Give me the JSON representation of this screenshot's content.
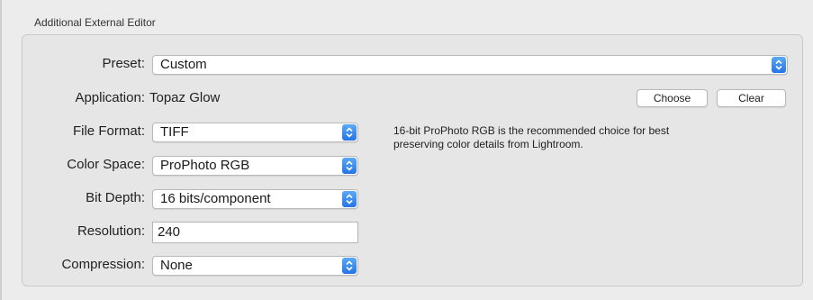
{
  "section": {
    "title": "Additional External Editor"
  },
  "preset": {
    "label": "Preset:",
    "value": "Custom"
  },
  "application": {
    "label": "Application:",
    "value": "Topaz Glow",
    "choose_label": "Choose",
    "clear_label": "Clear"
  },
  "file_format": {
    "label": "File Format:",
    "value": "TIFF"
  },
  "info_text": {
    "line1": "16-bit ProPhoto RGB is the recommended choice for best",
    "line2": "preserving color details from Lightroom."
  },
  "color_space": {
    "label": "Color Space:",
    "value": "ProPhoto RGB"
  },
  "bit_depth": {
    "label": "Bit Depth:",
    "value": "16 bits/component"
  },
  "resolution": {
    "label": "Resolution:",
    "value": "240"
  },
  "compression": {
    "label": "Compression:",
    "value": "None"
  },
  "colors": {
    "accent": "#2473e6",
    "panel_bg": "#e6e6e6",
    "window_bg": "#ececec"
  },
  "icons": {
    "popup_arrows": "chevron-up-down-icon"
  }
}
